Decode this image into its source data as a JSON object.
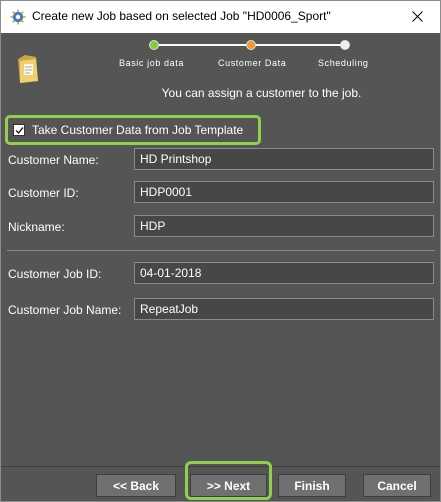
{
  "window": {
    "title": "Create new Job based on selected Job \"HD0006_Sport\""
  },
  "icons": {
    "app": "gear-app-icon",
    "close": "close-icon",
    "job_folder": "job-folder-icon",
    "checkmark": "checkmark-icon"
  },
  "steps": [
    {
      "label": "Basic job data",
      "color": "#7fcf3f"
    },
    {
      "label": "Customer Data",
      "color": "#f39a2f"
    },
    {
      "label": "Scheduling",
      "color": "#eeeeee"
    }
  ],
  "info": {
    "text": "You can assign a customer to the job."
  },
  "template_checkbox": {
    "label": "Take Customer Data from Job Template",
    "checked": true
  },
  "fields": {
    "customer_name": {
      "label": "Customer Name:",
      "value": "HD Printshop"
    },
    "customer_id": {
      "label": "Customer ID:",
      "value": "HDP0001"
    },
    "nickname": {
      "label": "Nickname:",
      "value": "HDP"
    },
    "customer_job_id": {
      "label": "Customer Job ID:",
      "value": "04-01-2018"
    },
    "customer_job_name": {
      "label": "Customer Job Name:",
      "value": "RepeatJob"
    }
  },
  "buttons": {
    "back": "<< Back",
    "next": ">> Next",
    "finish": "Finish",
    "cancel": "Cancel"
  },
  "colors": {
    "accent_highlight": "#8fd14f",
    "dialog_bg": "#555555"
  }
}
